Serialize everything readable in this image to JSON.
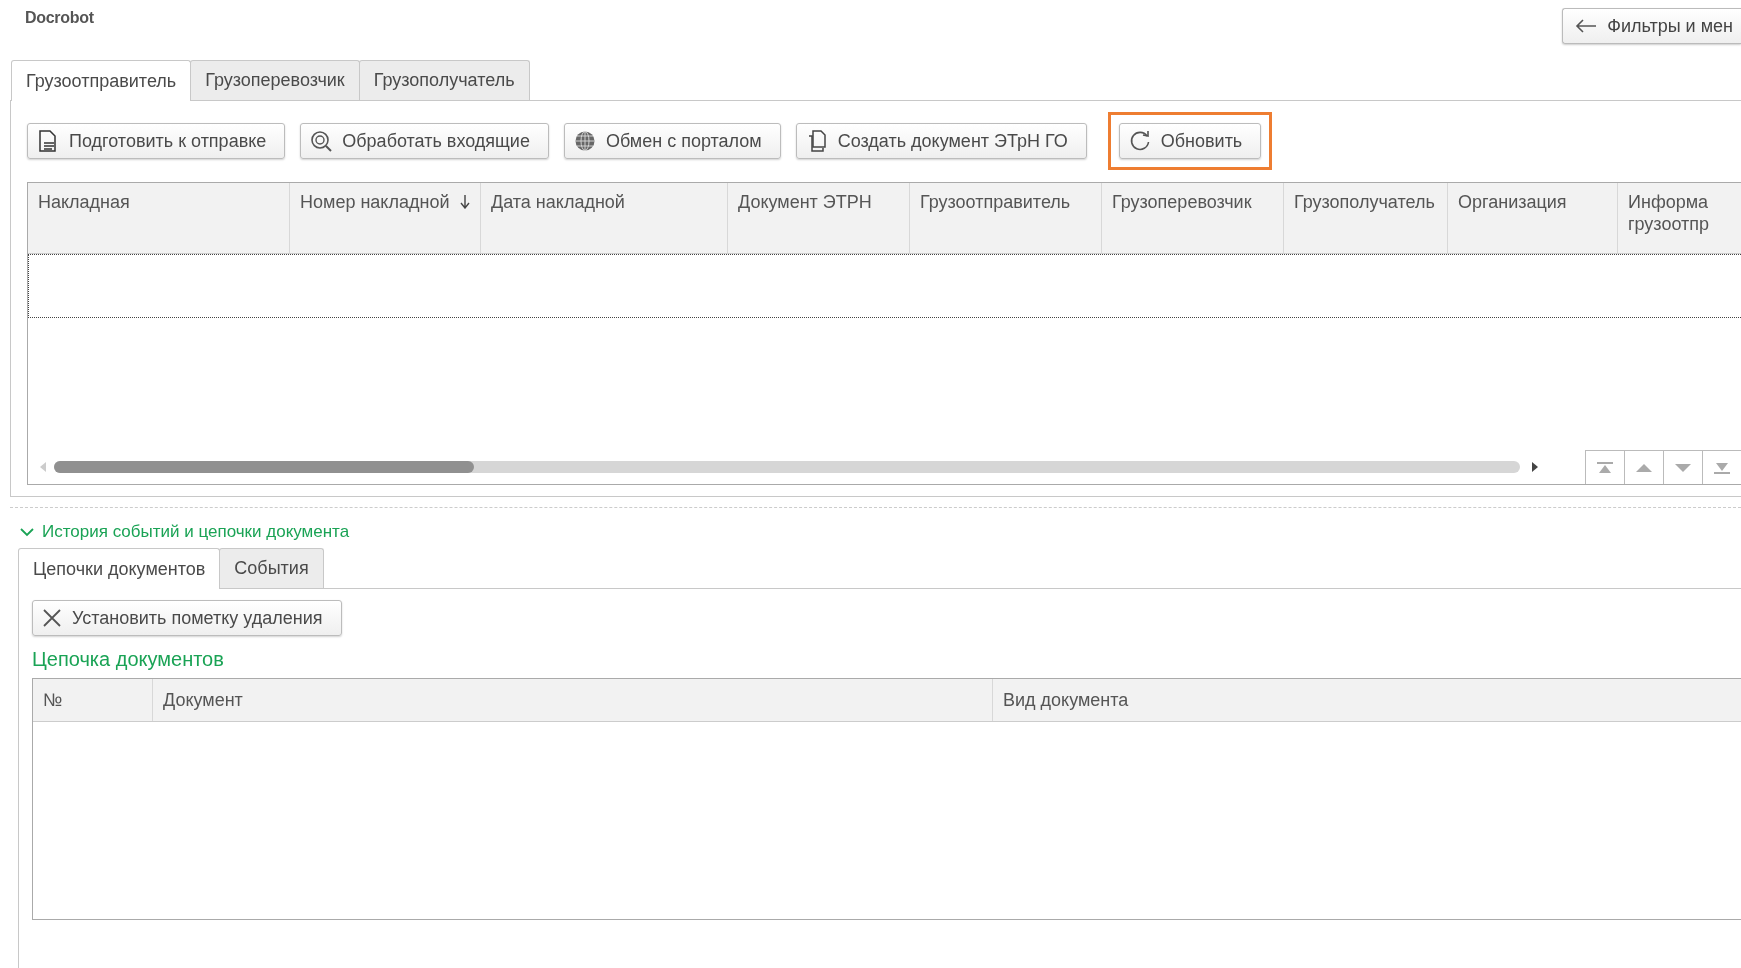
{
  "logo": {
    "text": "Docrobot"
  },
  "filters_button": {
    "label": "Фильтры и мен"
  },
  "tabs": [
    {
      "label": "Грузоотправитель",
      "selected": true
    },
    {
      "label": "Грузоперевозчик",
      "selected": false
    },
    {
      "label": "Грузополучатель",
      "selected": false
    }
  ],
  "toolbar": [
    {
      "label": "Подготовить к отправке",
      "kind": "xml",
      "highlighted": false
    },
    {
      "label": "Обработать входящие",
      "kind": "process",
      "highlighted": false
    },
    {
      "label": "Обмен с порталом",
      "kind": "globe",
      "highlighted": false
    },
    {
      "label": "Создать документ ЭТрН ГО",
      "kind": "copy",
      "highlighted": false
    },
    {
      "label": "Обновить",
      "kind": "refresh",
      "highlighted": true
    }
  ],
  "table": {
    "columns": [
      {
        "label": "Накладная",
        "sorted": false
      },
      {
        "label": "Номер накладной",
        "sorted": true
      },
      {
        "label": "Дата накладной",
        "sorted": false
      },
      {
        "label": "Документ ЭТРН",
        "sorted": false
      },
      {
        "label": "Грузоотправитель",
        "sorted": false
      },
      {
        "label": "Грузоперевозчик",
        "sorted": false
      },
      {
        "label": "Грузополучатель",
        "sorted": false
      },
      {
        "label": "Организация",
        "sorted": false
      },
      {
        "label": "Информа грузоотпр",
        "sorted": false
      }
    ]
  },
  "history": {
    "title": "История событий и цепочки документа",
    "expanded": true,
    "tabs": [
      {
        "label": "Цепочки документов",
        "selected": true
      },
      {
        "label": "События",
        "selected": false
      }
    ],
    "delete_button": {
      "label": "Установить пометку удаления"
    },
    "chain": {
      "title": "Цепочка документов",
      "columns": [
        "№",
        "Документ",
        "Вид документа"
      ]
    }
  }
}
